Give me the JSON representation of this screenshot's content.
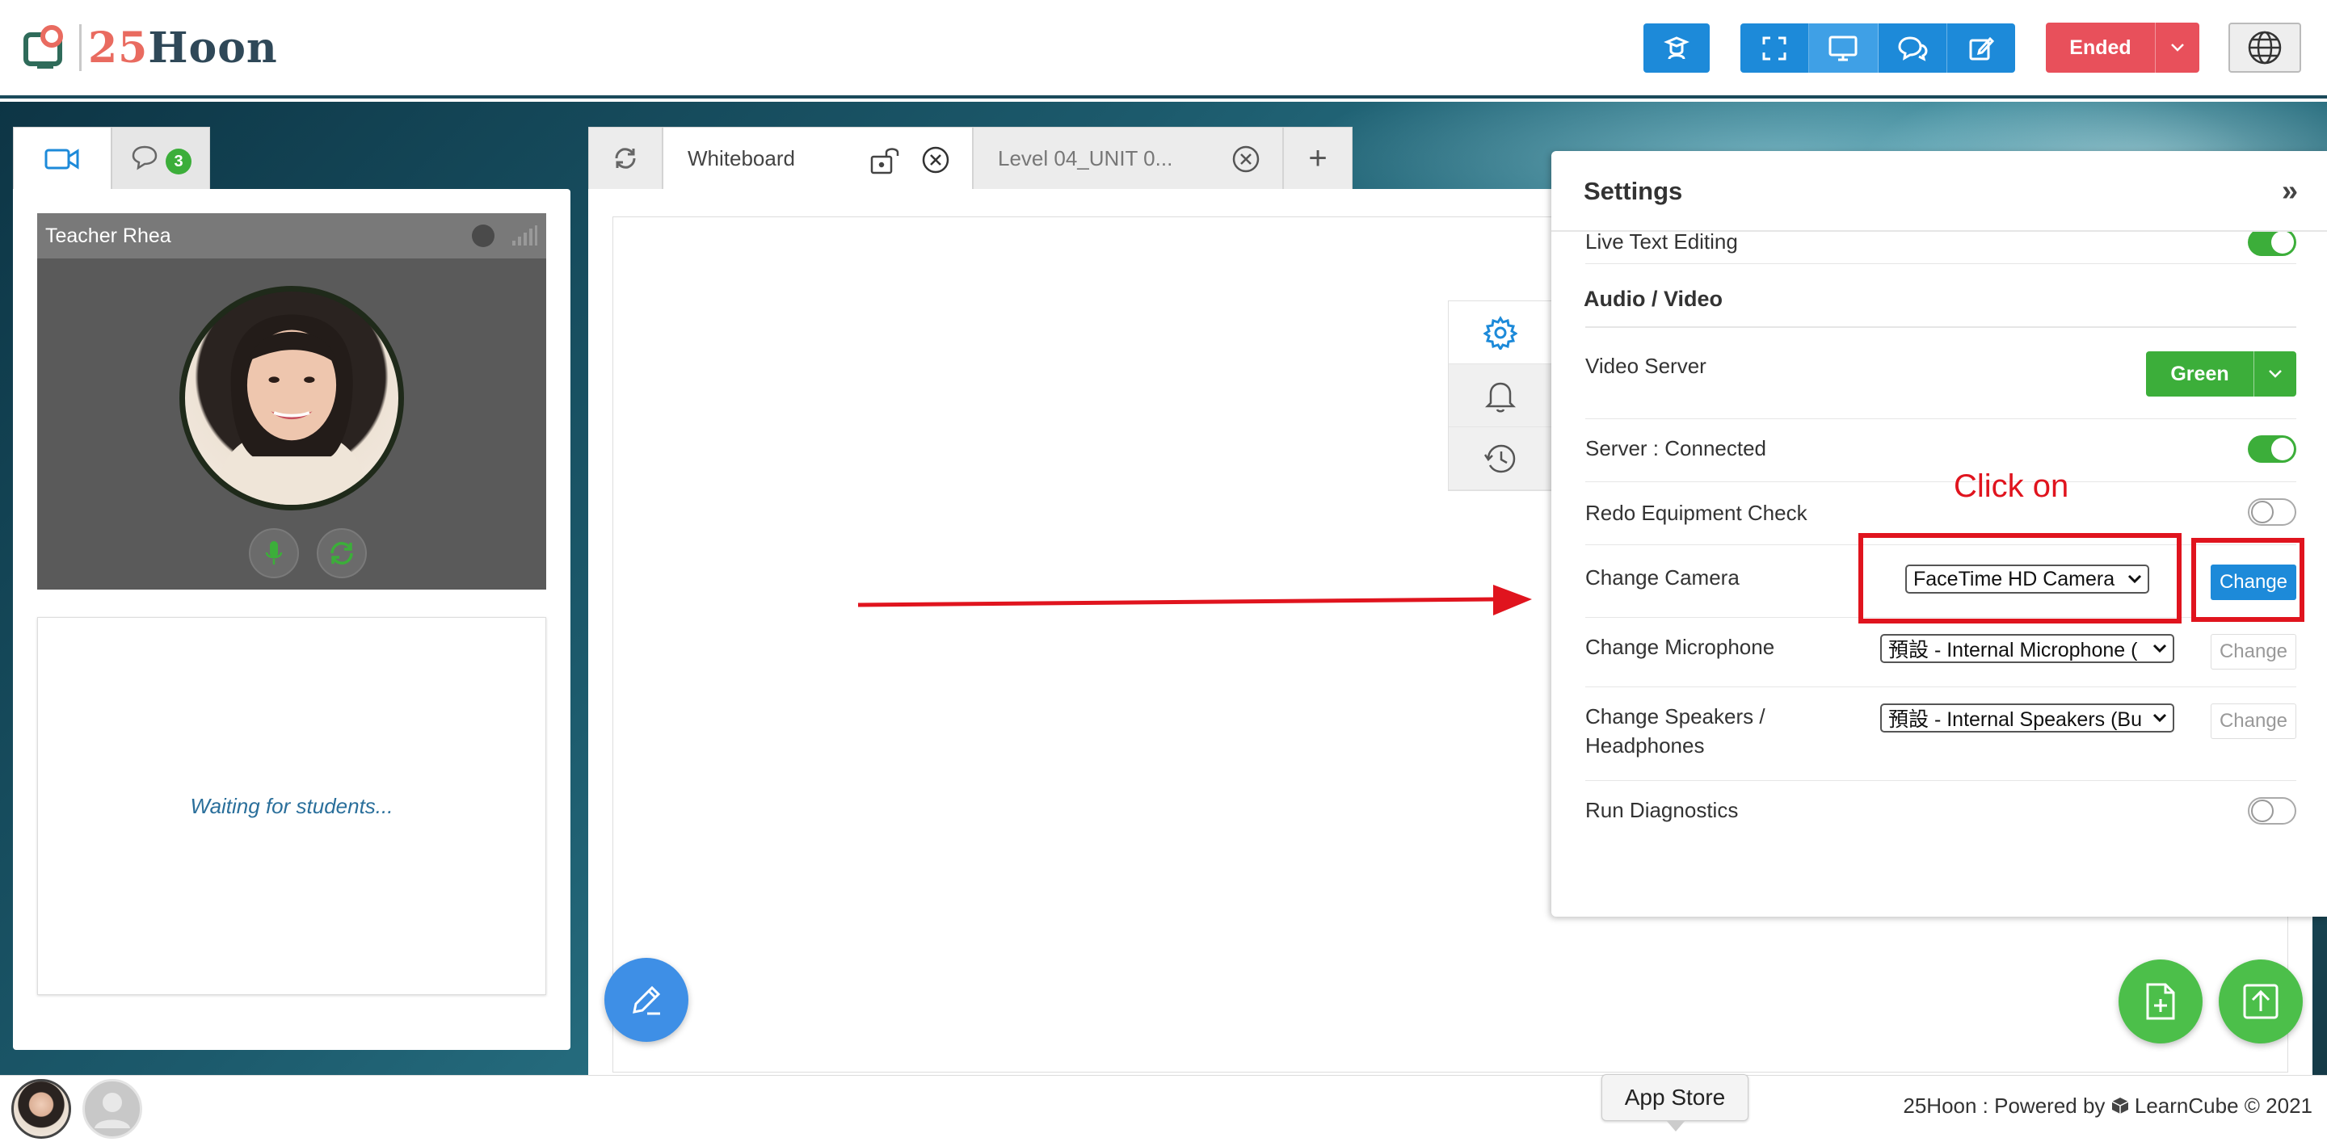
{
  "header": {
    "logo_text_num": "25",
    "logo_text_name": "Hoon",
    "ended_label": "Ended",
    "icons": [
      "teacher-icon",
      "fullscreen-icon",
      "screen-icon",
      "chat-icon",
      "edit-icon",
      "globe-icon"
    ]
  },
  "left_panel": {
    "chat_badge": "3",
    "video": {
      "teacher_name": "Teacher Rhea"
    },
    "waiting_text": "Waiting for students..."
  },
  "whiteboard": {
    "tabs": [
      {
        "label": "Whiteboard",
        "active": true
      },
      {
        "label": "Level 04_UNIT 0...",
        "active": false
      }
    ],
    "add_label": "+"
  },
  "settings": {
    "title": "Settings",
    "close_label": "»",
    "partial_row_label": "Live Text Editing",
    "section_title": "Audio / Video",
    "video_server": {
      "label": "Video Server",
      "value": "Green"
    },
    "server_status": {
      "label": "Server : Connected",
      "on": true
    },
    "redo_check": {
      "label": "Redo Equipment Check",
      "on": false
    },
    "camera": {
      "label": "Change Camera",
      "selected": "FaceTime HD Camera",
      "button": "Change"
    },
    "microphone": {
      "label": "Change Microphone",
      "selected": "預設 - Internal Microphone (",
      "button": "Change"
    },
    "speakers": {
      "label_line1": "Change Speakers /",
      "label_line2": "Headphones",
      "selected": "預設 - Internal Speakers (Bu",
      "button": "Change"
    },
    "diagnostics": {
      "label": "Run Diagnostics",
      "on": false
    }
  },
  "annotation": {
    "text": "Click on",
    "color": "#e0141e"
  },
  "footer": {
    "app_store": "App Store",
    "powered_prefix": "25Hoon : Powered by",
    "powered_brand": "LearnCube © 2021"
  },
  "colors": {
    "primary_blue": "#1d8ad9",
    "ended_red": "#e8505b",
    "green": "#3cae3a"
  }
}
